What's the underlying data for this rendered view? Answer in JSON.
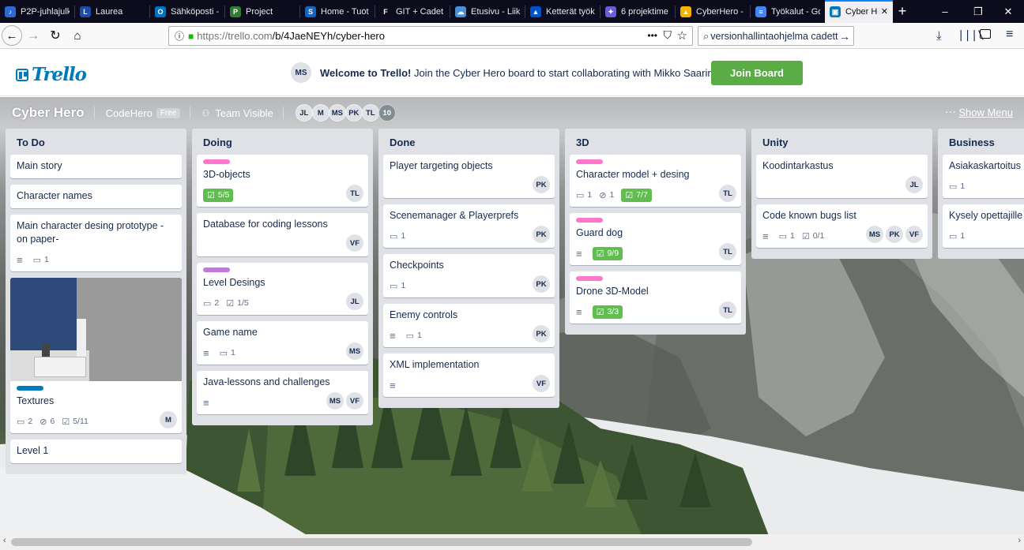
{
  "browser": {
    "tabs": [
      {
        "label": "P2P-juhlajulk",
        "icon_color": "#2a6ad1",
        "glyph": "♪"
      },
      {
        "label": "Laurea",
        "icon_color": "#1f4aa8",
        "glyph": "L"
      },
      {
        "label": "Sähköposti -",
        "icon_color": "#0072c6",
        "glyph": "O"
      },
      {
        "label": "Project",
        "icon_color": "#2e7d32",
        "glyph": "P"
      },
      {
        "label": "Home - Tuot",
        "icon_color": "#1565c0",
        "glyph": "S"
      },
      {
        "label": "GIT + Cadet",
        "icon_color": "#0c0c1c",
        "glyph": "F"
      },
      {
        "label": "Etusivu - Liik",
        "icon_color": "#4a90d9",
        "glyph": "☁"
      },
      {
        "label": "Ketterät työk",
        "icon_color": "#0052cc",
        "glyph": "▲"
      },
      {
        "label": "6 projektime",
        "icon_color": "#6b5bd6",
        "glyph": "✦"
      },
      {
        "label": "CyberHero -",
        "icon_color": "#f4b400",
        "glyph": "▲"
      },
      {
        "label": "Työkalut - Go",
        "icon_color": "#4285f4",
        "glyph": "≡"
      },
      {
        "label": "Cyber Hero",
        "icon_color": "#0079bf",
        "glyph": "▣",
        "active": true
      }
    ],
    "url_prefix": "https://trello.com",
    "url_path": "/b/4JaeNEYh/cyber-hero",
    "search_value": "versionhallintaohjelma cadett",
    "page_actions": "•••"
  },
  "topbar": {
    "logo": "Trello",
    "welcome_avatar": "MS",
    "welcome_bold": "Welcome to Trello!",
    "welcome_rest": " Join the Cyber Hero board to start collaborating with Mikko Saarinen.",
    "join_label": "Join Board"
  },
  "board": {
    "title": "Cyber Hero",
    "team": "CodeHero",
    "plan": "Free",
    "visibility": "Team Visible",
    "members": [
      "JL",
      "M",
      "MS",
      "PK",
      "TL"
    ],
    "more_members": "10",
    "show_menu": "Show Menu"
  },
  "lists": [
    {
      "title": "To Do",
      "cards": [
        {
          "title": "Main story"
        },
        {
          "title": "Character names"
        },
        {
          "title": "Main character desing prototype -on paper-",
          "desc": true,
          "comments": "1"
        },
        {
          "title": "Textures",
          "cover": true,
          "labels": [
            "#0079bf"
          ],
          "comments": "2",
          "attachments": "6",
          "checklist": "5/11",
          "members": [
            "M"
          ]
        },
        {
          "title": "Level 1"
        }
      ]
    },
    {
      "title": "Doing",
      "cards": [
        {
          "title": "3D-objects",
          "labels": [
            "#ff78cb"
          ],
          "checklist": "5/5",
          "check_done": true,
          "members": [
            "TL"
          ]
        },
        {
          "title": "Database for coding lessons",
          "members": [
            "VF"
          ]
        },
        {
          "title": "Level Desings",
          "labels": [
            "#c377e0"
          ],
          "comments": "2",
          "checklist": "1/5",
          "members": [
            "JL"
          ]
        },
        {
          "title": "Game name",
          "desc": true,
          "comments": "1",
          "members": [
            "MS"
          ]
        },
        {
          "title": "Java-lessons and challenges",
          "desc": true,
          "members": [
            "MS",
            "VF"
          ]
        }
      ]
    },
    {
      "title": "Done",
      "cards": [
        {
          "title": "Player targeting objects",
          "members": [
            "PK"
          ]
        },
        {
          "title": "Scenemanager & Playerprefs",
          "comments": "1",
          "members": [
            "PK"
          ]
        },
        {
          "title": "Checkpoints",
          "comments": "1",
          "members": [
            "PK"
          ]
        },
        {
          "title": "Enemy controls",
          "desc": true,
          "comments": "1",
          "members": [
            "PK"
          ]
        },
        {
          "title": "XML implementation",
          "desc": true,
          "members": [
            "VF"
          ]
        }
      ]
    },
    {
      "title": "3D",
      "cards": [
        {
          "title": "Character model + desing",
          "labels": [
            "#ff78cb"
          ],
          "comments": "1",
          "attachments": "1",
          "checklist": "7/7",
          "check_done": true,
          "members": [
            "TL"
          ]
        },
        {
          "title": "Guard dog",
          "labels": [
            "#ff78cb"
          ],
          "desc": true,
          "checklist": "9/9",
          "check_done": true,
          "members": [
            "TL"
          ]
        },
        {
          "title": "Drone 3D-Model",
          "labels": [
            "#ff78cb"
          ],
          "desc": true,
          "checklist": "3/3",
          "check_done": true,
          "members": [
            "TL"
          ]
        }
      ]
    },
    {
      "title": "Unity",
      "cards": [
        {
          "title": "Koodintarkastus",
          "members": [
            "JL"
          ]
        },
        {
          "title": "Code known bugs list",
          "desc": true,
          "comments": "1",
          "checklist": "0/1",
          "members": [
            "MS",
            "PK",
            "VF"
          ]
        }
      ]
    },
    {
      "title": "Business",
      "cards": [
        {
          "title": "Asiakaskartoitus",
          "comments": "1"
        },
        {
          "title": "Kysely opettajille",
          "comments": "1"
        }
      ]
    }
  ]
}
